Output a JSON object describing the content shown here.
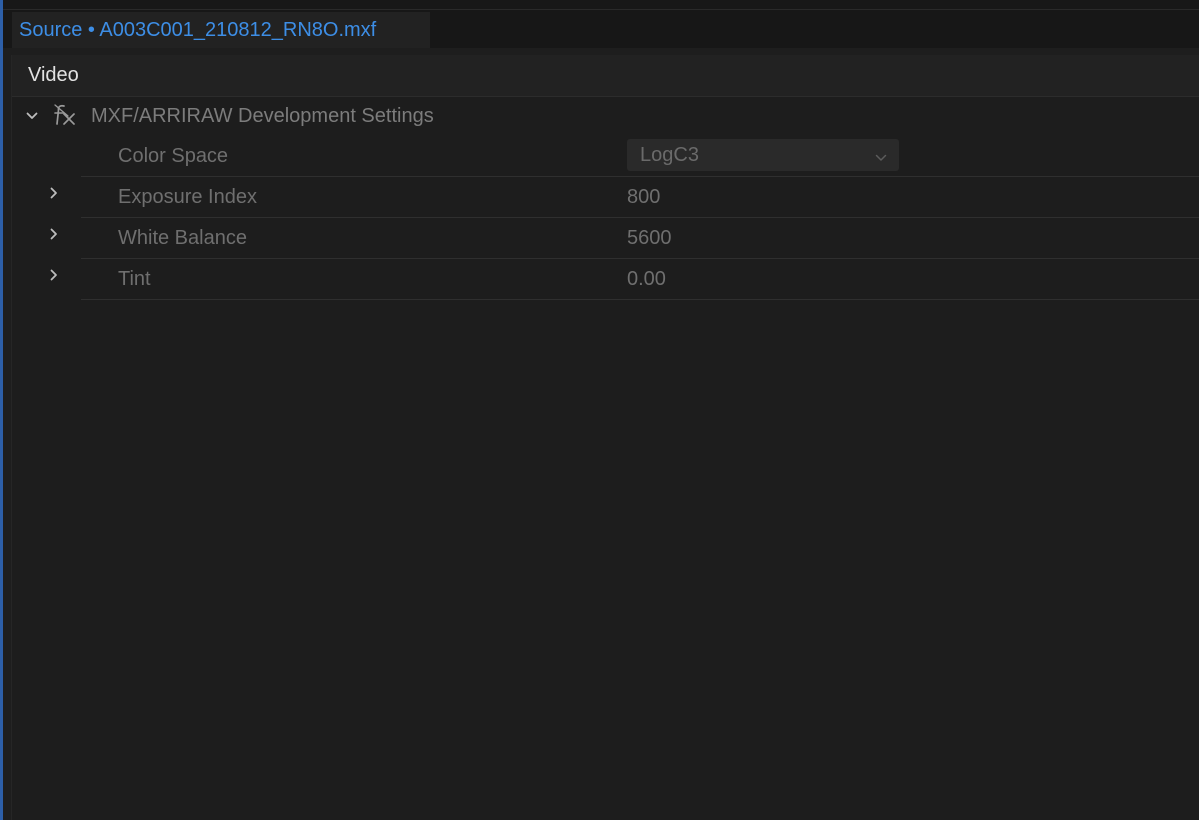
{
  "tab": {
    "title": "Source • A003C001_210812_RN8O.mxf"
  },
  "panel": {
    "section_label": "Video",
    "effect": {
      "name": "MXF/ARRIRAW Development Settings",
      "icon": "fx-icon",
      "expanded": true
    },
    "color_space": {
      "label": "Color Space",
      "selected": "LogC3"
    },
    "params": [
      {
        "label": "Exposure Index",
        "value": "800"
      },
      {
        "label": "White Balance",
        "value": "5600"
      },
      {
        "label": "Tint",
        "value": "0.00"
      }
    ]
  },
  "colors": {
    "accent": "#3d8ee6",
    "left_accent": "#2d5fa8",
    "panel_bg": "#1d1d1d",
    "disabled_text": "#6f6f6f"
  }
}
